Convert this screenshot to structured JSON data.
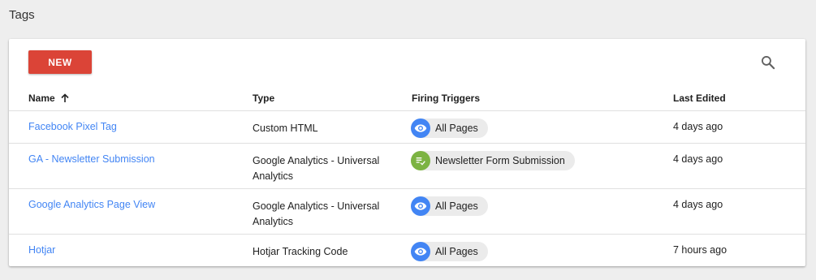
{
  "page": {
    "title": "Tags"
  },
  "toolbar": {
    "new_label": "NEW",
    "search_icon": "search-icon"
  },
  "table": {
    "headers": {
      "name": "Name",
      "type": "Type",
      "triggers": "Firing Triggers",
      "edited": "Last Edited"
    },
    "sort": {
      "column": "Name",
      "direction": "ascending",
      "icon": "arrow-up-icon"
    },
    "rows": [
      {
        "name": "Facebook Pixel Tag",
        "type_lines": [
          "Custom HTML"
        ],
        "trigger": {
          "label": "All Pages",
          "icon": "eye-icon",
          "color": "#4285f4"
        },
        "edited": "4 days ago"
      },
      {
        "name": "GA - Newsletter Submission",
        "type_lines": [
          "Google Analytics - Universal",
          "Analytics"
        ],
        "trigger": {
          "label": "Newsletter Form Submission",
          "icon": "form-submit-icon",
          "color": "#7cb342"
        },
        "edited": "4 days ago"
      },
      {
        "name": "Google Analytics Page View",
        "type_lines": [
          "Google Analytics - Universal",
          "Analytics"
        ],
        "trigger": {
          "label": "All Pages",
          "icon": "eye-icon",
          "color": "#4285f4"
        },
        "edited": "4 days ago"
      },
      {
        "name": "Hotjar",
        "type_lines": [
          "Hotjar Tracking Code"
        ],
        "trigger": {
          "label": "All Pages",
          "icon": "eye-icon",
          "color": "#4285f4"
        },
        "edited": "7 hours ago"
      }
    ]
  },
  "colors": {
    "accent": "#db4437",
    "link": "#4285f4",
    "page_bg": "#eeeeee"
  }
}
